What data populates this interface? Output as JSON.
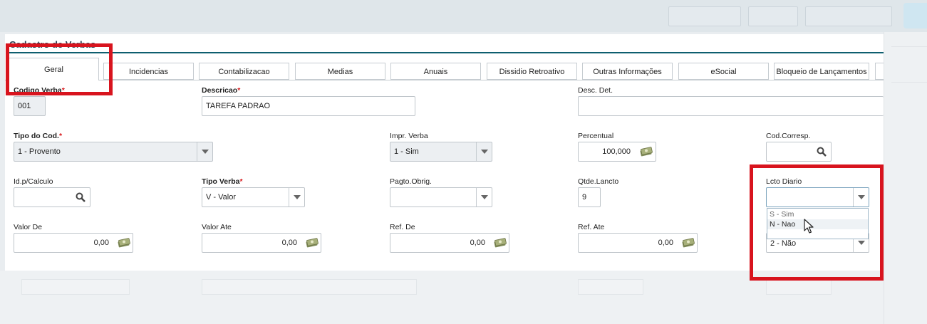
{
  "panel": {
    "title": "Cadastro de Verbas"
  },
  "tabs": [
    {
      "label": "Geral",
      "active": true
    },
    {
      "label": "Incidencias"
    },
    {
      "label": "Contabilizacao"
    },
    {
      "label": "Medias"
    },
    {
      "label": "Anuais"
    },
    {
      "label": "Dissidio Retroativo"
    },
    {
      "label": "Outras Informações"
    },
    {
      "label": "eSocial"
    },
    {
      "label": "Bloqueio de Lançamentos"
    }
  ],
  "fields": {
    "codigo_verba": {
      "label": "Codigo Verba",
      "value": "001"
    },
    "descricao": {
      "label": "Descricao",
      "value": "TAREFA PADRAO"
    },
    "desc_det": {
      "label": "Desc. Det.",
      "value": ""
    },
    "tipo_cod": {
      "label": "Tipo do Cod.",
      "value": "1 - Provento"
    },
    "impr_verba": {
      "label": "Impr. Verba",
      "value": "1 - Sim"
    },
    "percentual": {
      "label": "Percentual",
      "value": "100,000"
    },
    "cod_corresp": {
      "label": "Cod.Corresp.",
      "value": ""
    },
    "id_calculo": {
      "label": "Id.p/Calculo",
      "value": ""
    },
    "tipo_verba": {
      "label": "Tipo Verba",
      "value": "V - Valor"
    },
    "pagto_obrig": {
      "label": "Pagto.Obrig.",
      "value": ""
    },
    "qtde_lancto": {
      "label": "Qtde.Lancto",
      "value": "9"
    },
    "lcto_diario": {
      "label": "Lcto Diario",
      "value": ""
    },
    "valor_de": {
      "label": "Valor De",
      "value": "0,00"
    },
    "valor_ate": {
      "label": "Valor Ate",
      "value": "0,00"
    },
    "ref_de": {
      "label": "Ref. De",
      "value": "0,00"
    },
    "ref_ate": {
      "label": "Ref. Ate",
      "value": "0,00"
    },
    "hidden_select": {
      "value": "2 - Não"
    }
  },
  "dropdown": {
    "options": [
      "S - Sim",
      "N - Nao"
    ],
    "hovered": "N - Nao"
  },
  "colors": {
    "accent": "#0e5e6f",
    "highlight": "#d8141e",
    "required": "#d7191c"
  }
}
